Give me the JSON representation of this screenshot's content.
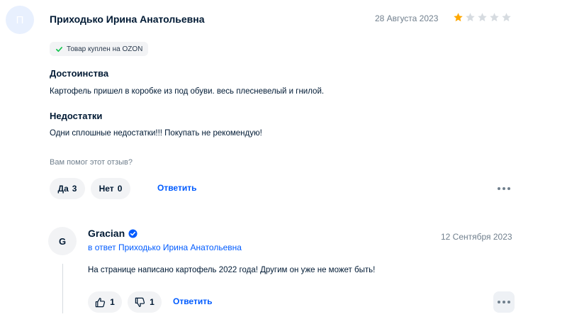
{
  "review": {
    "avatar_letter": "П",
    "author": "Приходько Ирина Анатольевна",
    "date": "28 Августа 2023",
    "rating": 1,
    "max_rating": 5,
    "badge": "Товар куплен на OZON",
    "pros_title": "Достоинства",
    "pros_text": "Картофель пришел в коробке из под обуви. весь плесневелый и гнилой.",
    "cons_title": "Недостатки",
    "cons_text": "Одни сплошные недостатки!!! Покупать не рекомендую!",
    "helpful_question": "Вам помог этот отзыв?",
    "yes_label": "Да",
    "yes_count": "3",
    "no_label": "Нет",
    "no_count": "0",
    "reply_label": "Ответить"
  },
  "reply": {
    "avatar_letter": "G",
    "author": "Gracian",
    "reply_to": "в ответ Приходько Ирина Анатольевна",
    "date": "12 Сентября 2023",
    "text": "На странице написано картофель 2022 года! Другим он уже не может быть!",
    "likes": "1",
    "dislikes": "1",
    "reply_label": "Ответить"
  },
  "colors": {
    "accent": "#005bff",
    "star_filled": "#ffa800",
    "star_empty": "#d6dbe0",
    "badge_check": "#10c44c"
  }
}
